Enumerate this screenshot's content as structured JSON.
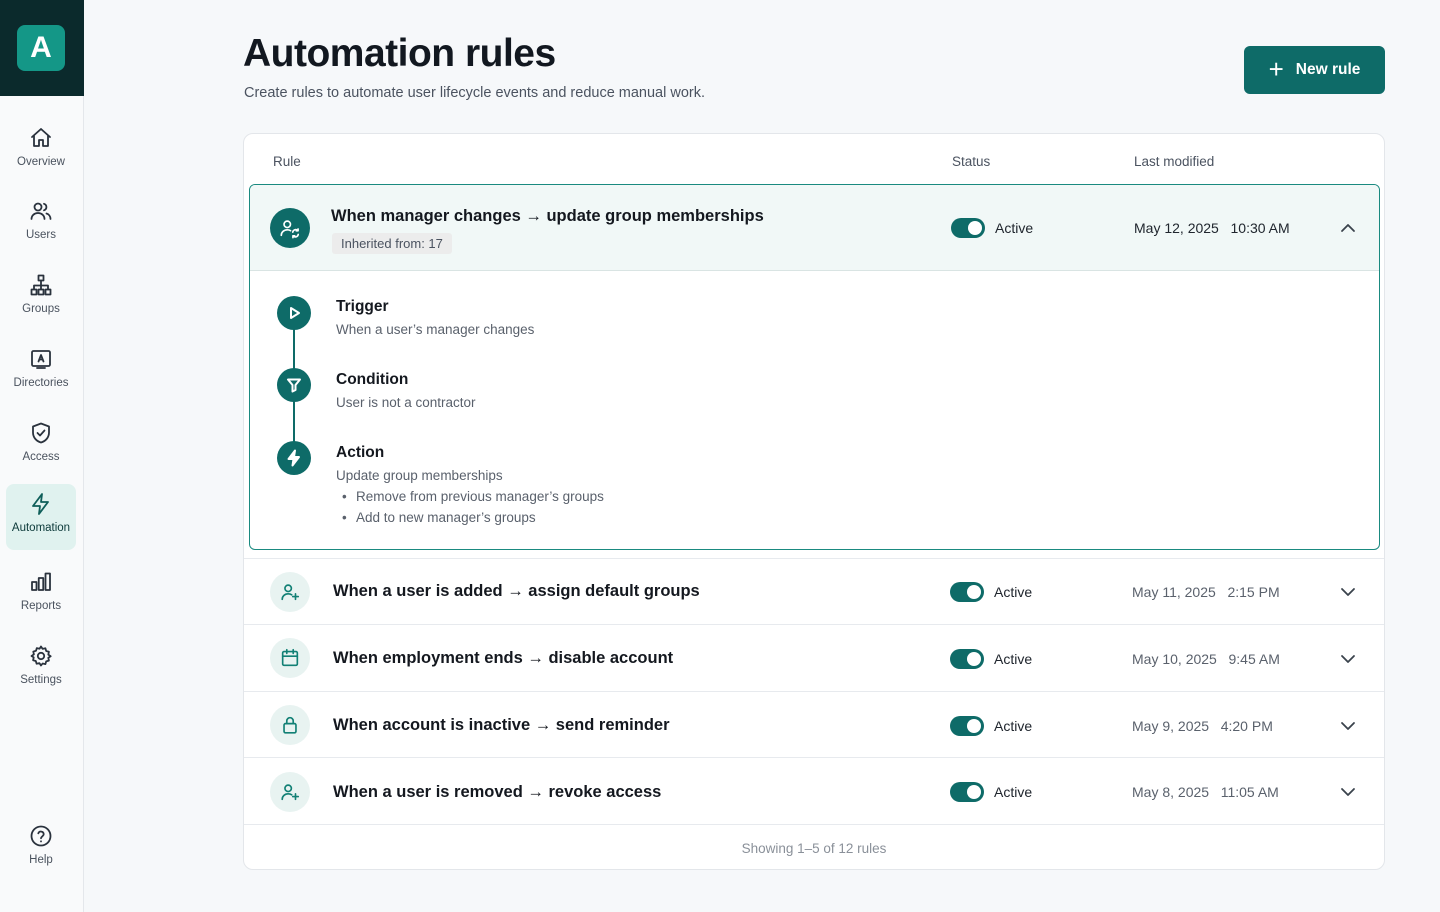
{
  "app": {
    "logo_letter": "A",
    "brand_color": "#0e6b68"
  },
  "sidebar": {
    "items": [
      {
        "label": "Overview",
        "icon": "home-icon"
      },
      {
        "label": "Users",
        "icon": "users-icon"
      },
      {
        "label": "Groups",
        "icon": "hierarchy-icon"
      },
      {
        "label": "Directories",
        "icon": "id-card-icon"
      },
      {
        "label": "Access",
        "icon": "shield-check-icon"
      },
      {
        "label": "Automation",
        "icon": "lightning-icon",
        "active": true
      },
      {
        "label": "Reports",
        "icon": "bar-chart-icon"
      },
      {
        "label": "Settings",
        "icon": "gear-icon"
      }
    ],
    "help_label": "Help"
  },
  "header": {
    "title": "Automation rules",
    "subtitle": "Create rules to automate user lifecycle events and reduce manual work.",
    "new_rule_label": "New rule"
  },
  "table": {
    "columns": {
      "rule": "Rule",
      "status": "Status",
      "modified": "Last modified"
    },
    "expanded_rule": {
      "title": "When manager changes → update group memberships",
      "badge": "Inherited from: 17",
      "status": "Active",
      "modified": "May 12, 2025   10:30 AM",
      "icon": "user-sync-icon",
      "steps": {
        "trigger": {
          "title": "Trigger",
          "desc": "When a user’s manager changes",
          "icon": "play-icon"
        },
        "condition": {
          "title": "Condition",
          "desc": "User is not a contractor",
          "icon": "filter-icon"
        },
        "action": {
          "title": "Action",
          "desc": "Update group memberships",
          "icon": "lightning-icon",
          "bullets": [
            "Remove from previous manager’s groups",
            "Add to new manager’s groups"
          ]
        }
      }
    },
    "rows": [
      {
        "title": "When a user is added → assign default groups",
        "status": "Active",
        "modified": "May 11, 2025   2:15 PM",
        "icon": "user-plus-icon"
      },
      {
        "title": "When employment ends → disable account",
        "status": "Active",
        "modified": "May 10, 2025   9:45 AM",
        "icon": "calendar-icon"
      },
      {
        "title": "When account is inactive → send reminder",
        "status": "Active",
        "modified": "May 9, 2025   4:20 PM",
        "icon": "lock-icon"
      },
      {
        "title": "When a user is removed → revoke access",
        "status": "Active",
        "modified": "May 8, 2025   11:05 AM",
        "icon": "user-plus-icon"
      }
    ],
    "footer": "Showing 1–5 of 12 rules"
  }
}
